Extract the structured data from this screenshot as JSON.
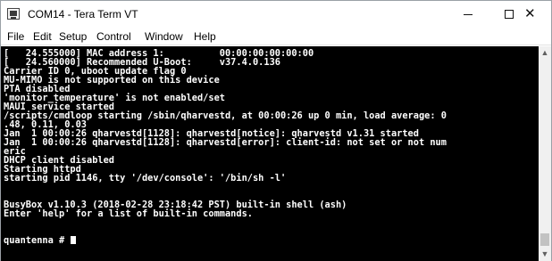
{
  "window": {
    "title": "COM14 - Tera Term VT",
    "controls": {
      "minimize": "–",
      "maximize": "□",
      "close": "✕"
    }
  },
  "menu": [
    "File",
    "Edit",
    "Setup",
    "Control",
    "Window",
    "Help"
  ],
  "terminal": {
    "lines": [
      "[   24.555000] MAC address 1:          00:00:00:00:00:00",
      "[   24.560000] Recommended U-Boot:     v37.4.0.136",
      "Carrier ID 0, uboot update flag 0",
      "MU-MIMO is not supported on this device",
      "PTA disabled",
      "'monitor_temperature' is not enabled/set",
      "MAUI service started",
      "/scripts/cmdloop starting /sbin/qharvestd, at 00:00:26 up 0 min, load average: 0",
      ".48, 0.11, 0.03",
      "Jan  1 00:00:26 qharvestd[1128]: qharvestd[notice]: qharvestd v1.31 started",
      "Jan  1 00:00:26 qharvestd[1128]: qharvestd[error]: client-id: not set or not num",
      "eric",
      "DHCP client disabled",
      "Starting httpd",
      "starting pid 1146, tty '/dev/console': '/bin/sh -l'",
      "",
      "",
      "BusyBox v1.10.3 (2018-02-28 23:18:42 PST) built-in shell (ash)",
      "Enter 'help' for a list of built-in commands.",
      "",
      "",
      "quantenna # "
    ]
  },
  "colors": {
    "terminal_bg": "#000000",
    "terminal_fg": "#ffffff",
    "chrome_bg": "#ffffff"
  },
  "icons": {
    "app": "tera-term-icon",
    "scroll_up": "chevron-up-icon",
    "scroll_down": "chevron-down-icon"
  }
}
